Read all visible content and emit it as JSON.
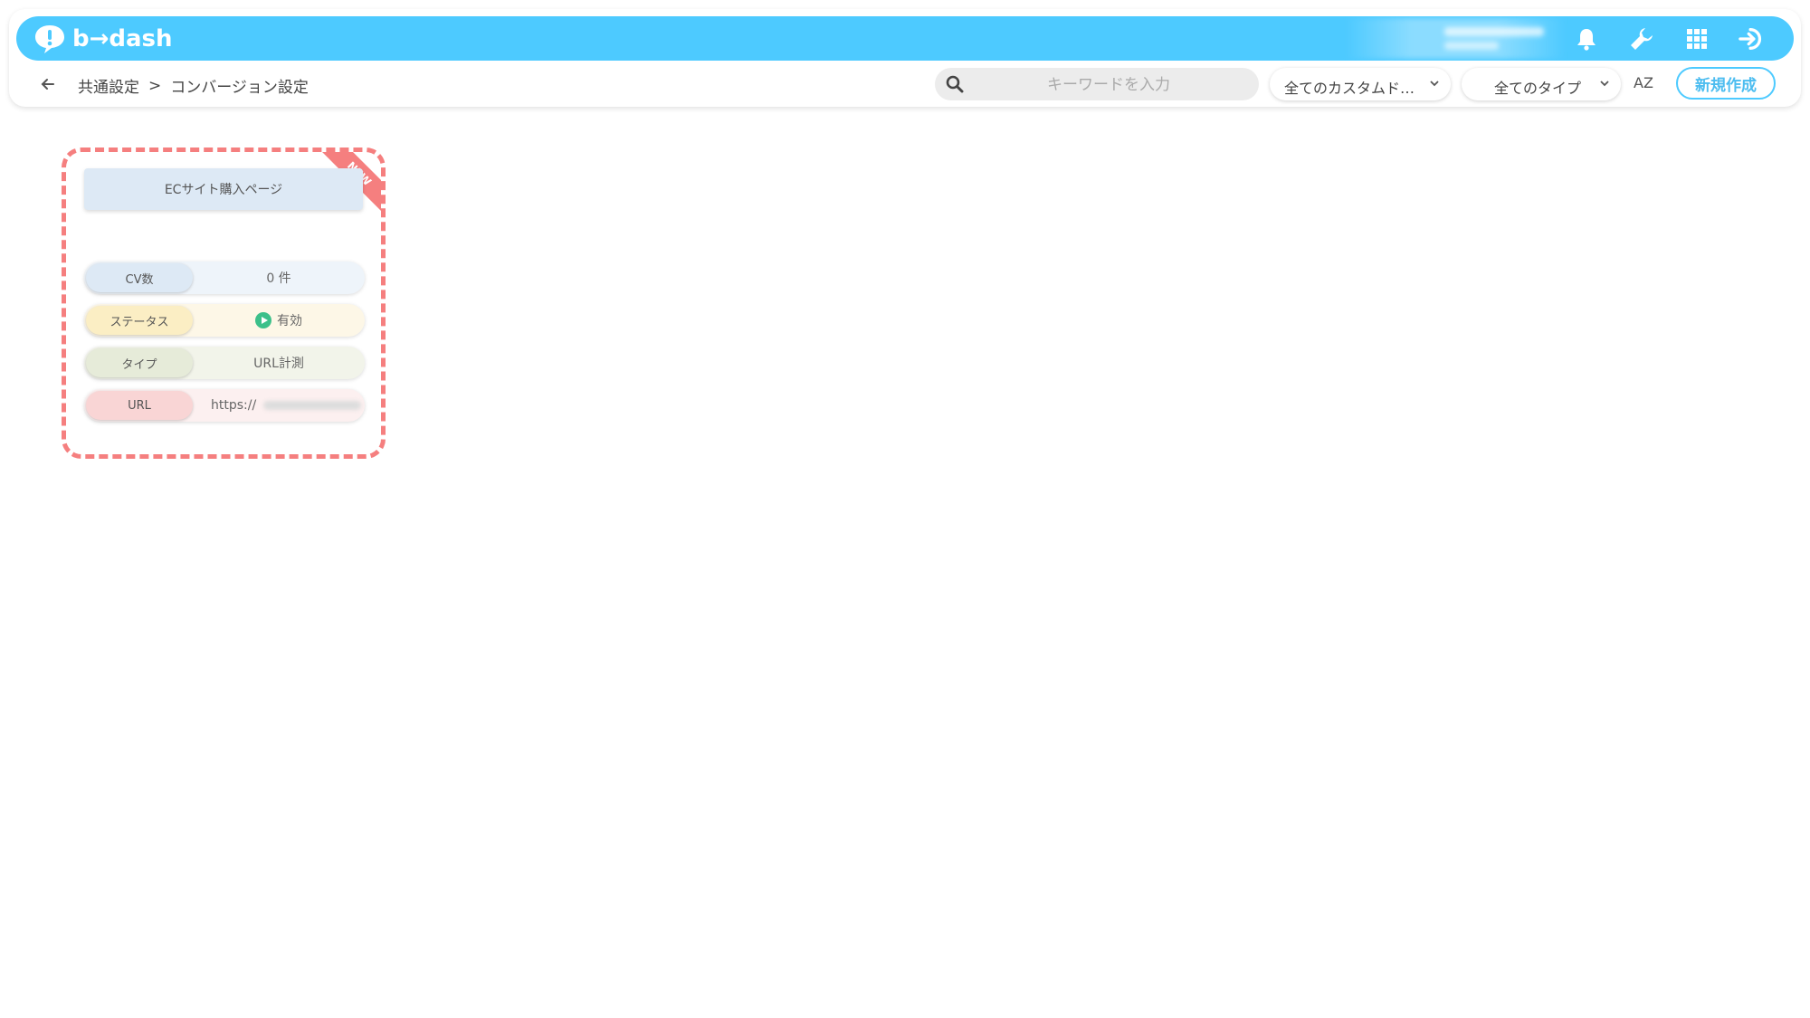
{
  "header": {
    "logo_text": "b→dash",
    "brand_color": "#4dcaff",
    "icons": [
      "bell-icon",
      "wrench-icon",
      "grid-icon",
      "logout-icon"
    ]
  },
  "breadcrumb": {
    "parent": "共通設定",
    "separator": ">",
    "current": "コンバージョン設定"
  },
  "toolbar": {
    "search_placeholder": "キーワードを入力",
    "filter_custom": "全てのカスタムド…",
    "filter_type": "全てのタイプ",
    "sort_label": "AZ",
    "new_button": "新規作成"
  },
  "card": {
    "badge": "NEW",
    "title": "ECサイト購入ページ",
    "accent_color": "#f57f7f",
    "rows": [
      {
        "key": "CV数",
        "value": "0 件"
      },
      {
        "key": "ステータス",
        "value": "有効",
        "status_color": "#3cc08a"
      },
      {
        "key": "タイプ",
        "value": "URL計測"
      },
      {
        "key": "URL",
        "value": "https://"
      }
    ]
  }
}
